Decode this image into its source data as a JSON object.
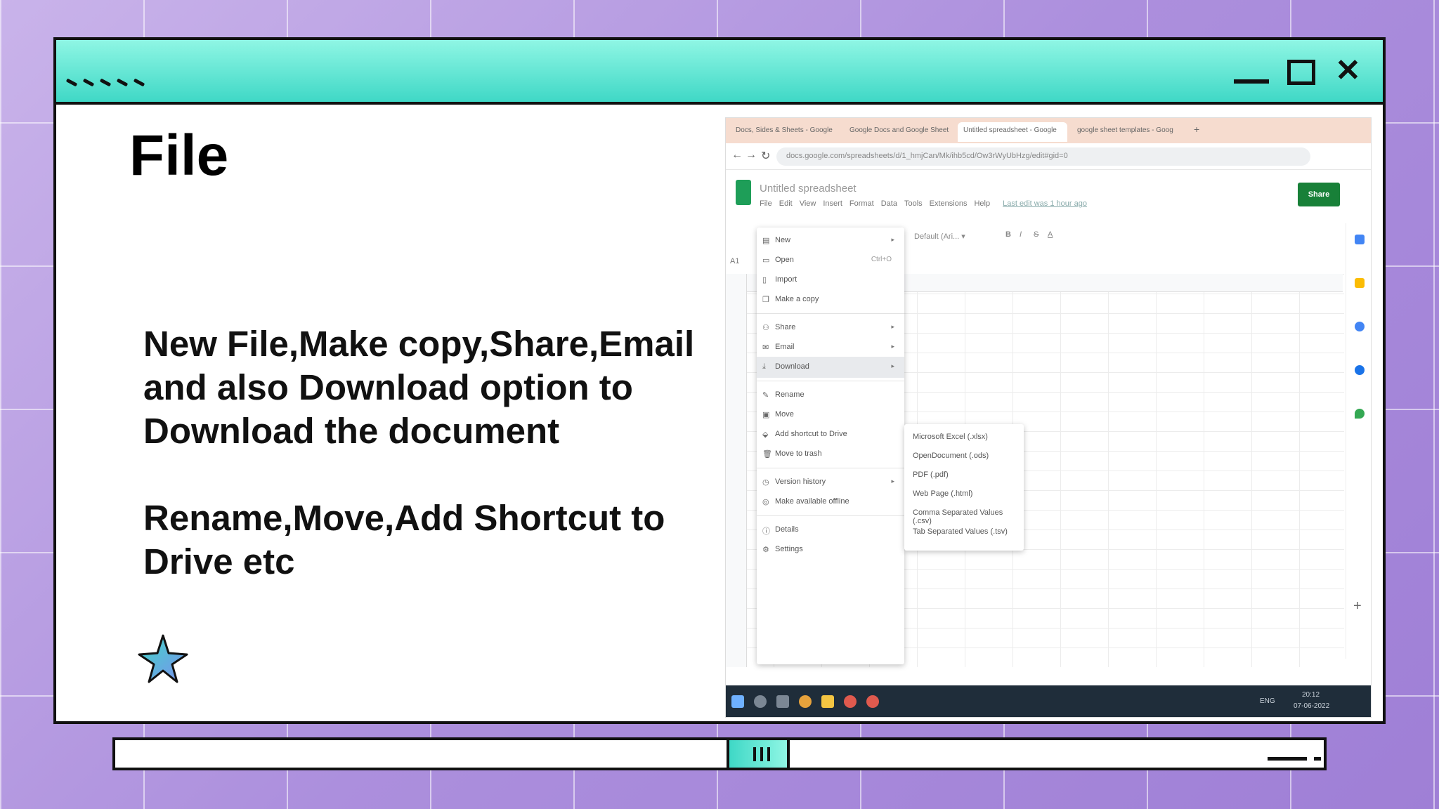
{
  "slide": {
    "title": "File",
    "bullet1": "New File,Make copy,Share,Email and also Download option to Download the document",
    "bullet2": "Rename,Move,Add Shortcut to Drive etc"
  },
  "screenshot": {
    "tabs": [
      "Docs, Sides & Sheets - Google",
      "Google Docs and Google Sheet",
      "Untitled spreadsheet - Google",
      "google sheet templates - Goog"
    ],
    "url": "docs.google.com/spreadsheets/d/1_hmjCan/Mk/ihb5cd/Ow3rWyUbHzg/edit#gid=0",
    "doc_title": "Untitled spreadsheet",
    "menubar": [
      "File",
      "Edit",
      "View",
      "Insert",
      "Format",
      "Data",
      "Tools",
      "Extensions",
      "Help"
    ],
    "last_edit": "Last edit was 1 hour ago",
    "share_label": "Share",
    "cell_ref": "A1",
    "file_menu": {
      "new": "New",
      "open": "Open",
      "open_shortcut": "Ctrl+O",
      "import": "Import",
      "make_copy": "Make a copy",
      "share": "Share",
      "email": "Email",
      "download": "Download",
      "rename": "Rename",
      "move": "Move",
      "add_shortcut": "Add shortcut to Drive",
      "move_to_trash": "Move to trash",
      "version_history": "Version history",
      "make_offline": "Make available offline",
      "details": "Details",
      "settings": "Settings"
    },
    "download_submenu": [
      "Microsoft Excel (.xlsx)",
      "OpenDocument (.ods)",
      "PDF (.pdf)",
      "Web Page (.html)",
      "Comma Separated Values (.csv)",
      "Tab Separated Values (.tsv)"
    ],
    "taskbar": {
      "lang": "ENG",
      "time": "20:12",
      "date": "07-06-2022"
    }
  }
}
